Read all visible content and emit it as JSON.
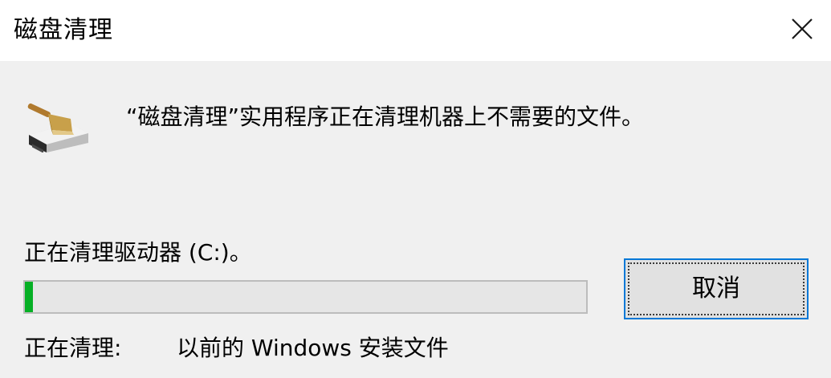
{
  "window": {
    "title": "磁盘清理"
  },
  "main": {
    "message": "“磁盘清理”实用程序正在清理机器上不需要的文件。",
    "drive_status": "正在清理驱动器 (C:)。",
    "progress_fraction": 0.014,
    "cleaning_label": "正在清理:",
    "cleaning_item": "以前的 Windows 安装文件",
    "cancel_label": "取消"
  },
  "icons": {
    "close": "close-icon",
    "app": "disk-cleanup-icon"
  },
  "colors": {
    "accent": "#0078d7",
    "progress": "#06b025"
  }
}
